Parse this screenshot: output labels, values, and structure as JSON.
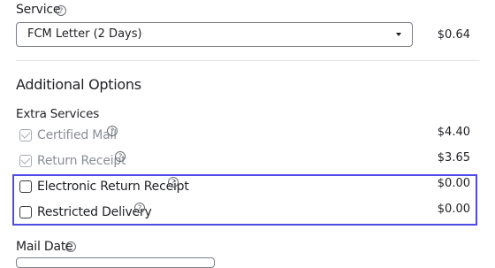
{
  "service": {
    "label": "Service",
    "selected": "FCM Letter (2 Days)",
    "price": "$0.64"
  },
  "additional_options": {
    "heading": "Additional Options"
  },
  "extra_services": {
    "label": "Extra Services",
    "items": [
      {
        "label": "Certified Mail",
        "price": "$4.40",
        "checked": true,
        "disabled": true
      },
      {
        "label": "Return Receipt",
        "price": "$3.65",
        "checked": true,
        "disabled": true
      },
      {
        "label": "Electronic Return Receipt",
        "price": "$0.00",
        "checked": false,
        "disabled": false
      },
      {
        "label": "Restricted Delivery",
        "price": "$0.00",
        "checked": false,
        "disabled": false
      }
    ]
  },
  "mail_date": {
    "label": "Mail Date"
  },
  "icons": {
    "help_glyph": "?"
  },
  "colors": {
    "highlight": "#4e4be6",
    "muted_text": "#8a8e95"
  }
}
